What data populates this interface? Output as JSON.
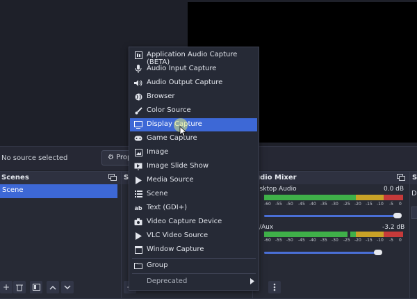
{
  "context_bar": {
    "no_source_label": "No source selected",
    "properties_label": "Prop"
  },
  "scenes": {
    "title": "Scenes",
    "items": [
      "Scene"
    ]
  },
  "sources": {
    "title_fragment": "S"
  },
  "audio_mixer": {
    "title": "udio Mixer",
    "channels": [
      {
        "name": "esktop Audio",
        "db": "0.0 dB",
        "level": 0.95
      },
      {
        "name": "c/Aux",
        "db": "-3.2 dB",
        "level": 0.82
      }
    ],
    "ticks": [
      "-60",
      "-55",
      "-50",
      "-45",
      "-40",
      "-35",
      "-30",
      "-25",
      "-20",
      "-15",
      "-10",
      "-5",
      "0"
    ]
  },
  "right_dock": {
    "title_fragment": "S",
    "letter": "D"
  },
  "menu": {
    "items": [
      {
        "label": "Application Audio Capture (BETA)",
        "icon": "app-audio-icon"
      },
      {
        "label": "Audio Input Capture",
        "icon": "microphone-icon"
      },
      {
        "label": "Audio Output Capture",
        "icon": "speaker-icon"
      },
      {
        "label": "Browser",
        "icon": "globe-icon"
      },
      {
        "label": "Color Source",
        "icon": "paintbrush-icon"
      },
      {
        "label": "Display Capture",
        "icon": "monitor-icon",
        "selected": true
      },
      {
        "label": "Game Capture",
        "icon": "gamepad-icon"
      },
      {
        "label": "Image",
        "icon": "image-icon"
      },
      {
        "label": "Image Slide Show",
        "icon": "slideshow-icon"
      },
      {
        "label": "Media Source",
        "icon": "play-icon"
      },
      {
        "label": "Scene",
        "icon": "list-icon"
      },
      {
        "label": "Text (GDI+)",
        "icon": "text-icon"
      },
      {
        "label": "Video Capture Device",
        "icon": "camera-icon"
      },
      {
        "label": "VLC Video Source",
        "icon": "play-icon"
      },
      {
        "label": "Window Capture",
        "icon": "window-icon"
      }
    ],
    "group_label": "Group",
    "deprecated_label": "Deprecated"
  },
  "colors": {
    "accent": "#3d68d6",
    "meter_green": "#3fb049",
    "meter_yellow": "#c9a227",
    "meter_red": "#c53a3a"
  }
}
